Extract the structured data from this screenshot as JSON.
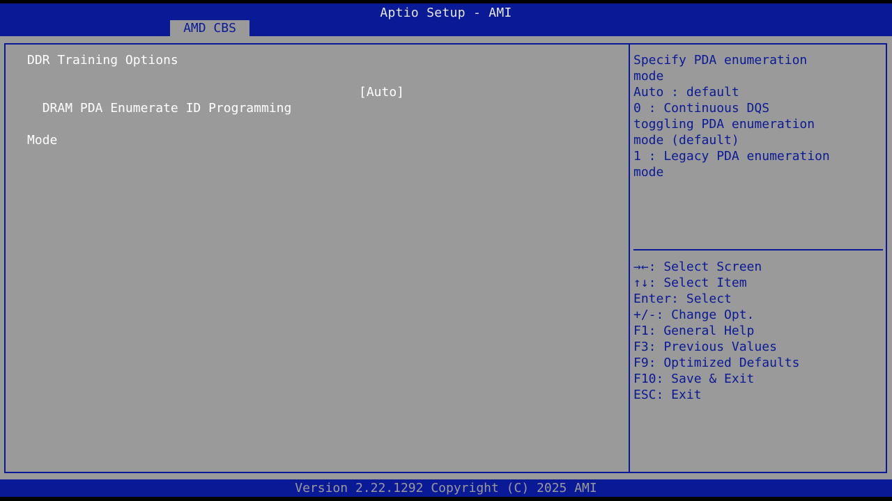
{
  "header": {
    "title": "Aptio Setup - AMI",
    "active_tab": "AMD CBS"
  },
  "main": {
    "section_title": "DDR Training Options",
    "setting": {
      "label_line1": "DRAM PDA Enumerate ID Programming",
      "label_line2": "Mode",
      "value": "[Auto]"
    }
  },
  "help": {
    "lines": [
      "Specify PDA enumeration",
      "mode",
      "Auto : default",
      "0 : Continuous DQS",
      "toggling PDA enumeration",
      "mode (default)",
      "1 : Legacy PDA enumeration",
      "mode"
    ]
  },
  "keys": [
    "→←: Select Screen",
    "↑↓: Select Item",
    "Enter: Select",
    "+/-: Change Opt.",
    "F1: General Help",
    "F3: Previous Values",
    "F9: Optimized Defaults",
    "F10: Save & Exit",
    "ESC: Exit"
  ],
  "footer": {
    "version": "Version 2.22.1292 Copyright (C) 2025 AMI"
  },
  "colors": {
    "bios_blue": "#0a1a96",
    "panel_gray": "#9a9a9a",
    "text_white": "#ffffff"
  }
}
